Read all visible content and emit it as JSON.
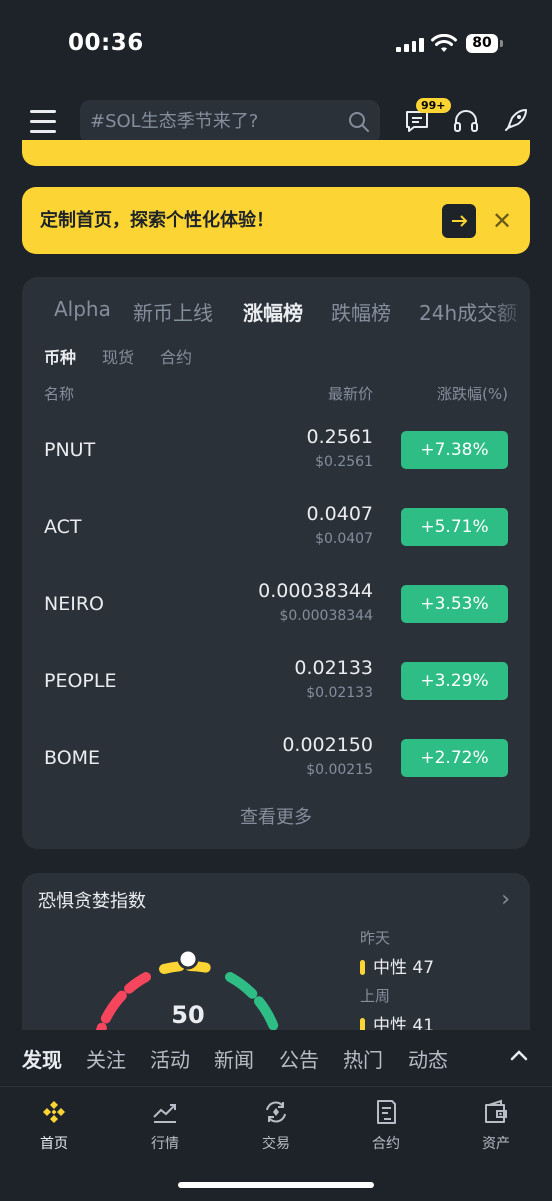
{
  "status_bar": {
    "time": "00:36",
    "battery": "80"
  },
  "header": {
    "search_placeholder": "#SOL生态季节来了?",
    "message_badge": "99+"
  },
  "banner": {
    "text": "定制首页，探索个性化体验！"
  },
  "market": {
    "tabs": [
      "Alpha",
      "新币上线",
      "涨幅榜",
      "跌幅榜",
      "24h成交额"
    ],
    "active_tab": "涨幅榜",
    "subtabs": [
      "币种",
      "现货",
      "合约"
    ],
    "columns": {
      "name": "名称",
      "price": "最新价",
      "change": "涨跌幅(%)"
    },
    "rows": [
      {
        "symbol": "PNUT",
        "price": "0.2561",
        "usd": "$0.2561",
        "change": "+7.38%"
      },
      {
        "symbol": "ACT",
        "price": "0.0407",
        "usd": "$0.0407",
        "change": "+5.71%"
      },
      {
        "symbol": "NEIRO",
        "price": "0.00038344",
        "usd": "$0.00038344",
        "change": "+3.53%"
      },
      {
        "symbol": "PEOPLE",
        "price": "0.02133",
        "usd": "$0.02133",
        "change": "+3.29%"
      },
      {
        "symbol": "BOME",
        "price": "0.002150",
        "usd": "$0.00215",
        "change": "+2.72%"
      }
    ],
    "view_more": "查看更多"
  },
  "fear_greed": {
    "title": "恐惧贪婪指数",
    "value": "50",
    "yesterday_label": "昨天",
    "yesterday_value": "中性 47",
    "last_week_label": "上周",
    "last_week_value": "中性 41",
    "colors": {
      "fear": "#f6465d",
      "neutral": "#fcd535",
      "greed": "#2ebd85"
    }
  },
  "discover_tabs": [
    "发现",
    "关注",
    "活动",
    "新闻",
    "公告",
    "热门",
    "动态"
  ],
  "bottom_nav": [
    {
      "label": "首页",
      "icon": "home-icon"
    },
    {
      "label": "行情",
      "icon": "markets-icon"
    },
    {
      "label": "交易",
      "icon": "trade-icon"
    },
    {
      "label": "合约",
      "icon": "futures-icon"
    },
    {
      "label": "资产",
      "icon": "wallet-icon"
    }
  ],
  "colors": {
    "accent": "#fcd535",
    "up": "#2ebd85",
    "background": "#1e2329",
    "card": "#2b3139"
  }
}
